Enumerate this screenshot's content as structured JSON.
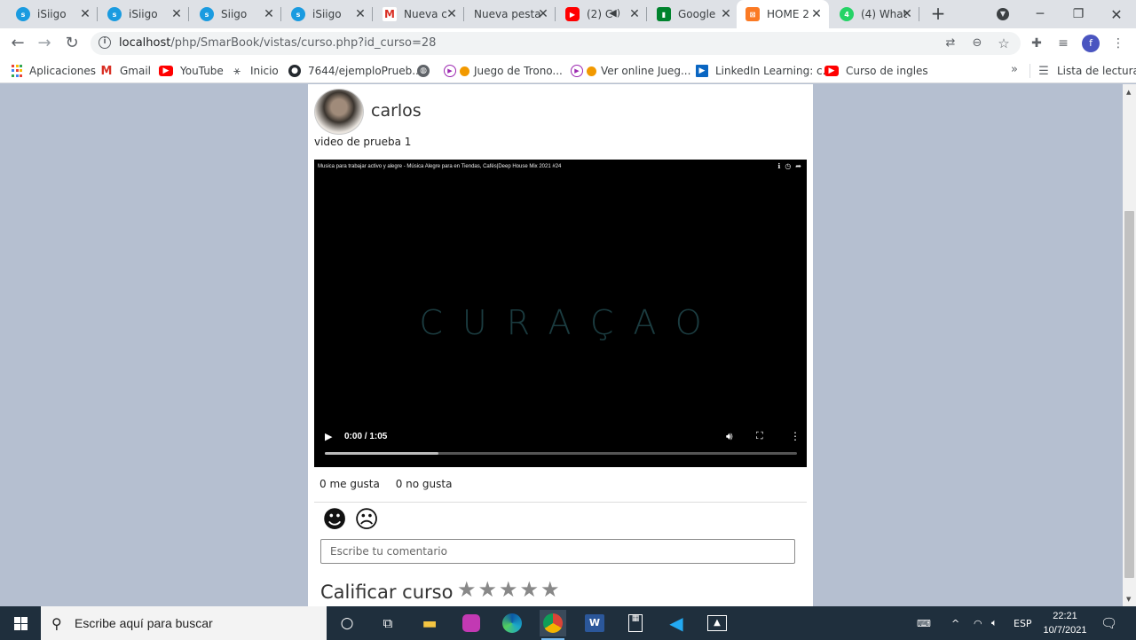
{
  "browser": {
    "tabs": [
      {
        "title": "iSiigo",
        "favicon": "siigo-icon",
        "color": "#1a9be0"
      },
      {
        "title": "iSiigo",
        "favicon": "siigo-icon",
        "color": "#1a9be0"
      },
      {
        "title": "Siigo",
        "favicon": "siigo-icon",
        "color": "#1a9be0"
      },
      {
        "title": "iSiigo",
        "favicon": "siigo-icon",
        "color": "#1a9be0"
      },
      {
        "title": "Nueva c",
        "favicon": "gmail-icon",
        "color": "#d93025"
      },
      {
        "title": "Nueva pesta",
        "favicon": "none",
        "color": "#dee1e6"
      },
      {
        "title": "(2) C",
        "favicon": "youtube-icon",
        "color": "#ff0000"
      },
      {
        "title": "Google",
        "favicon": "meet-icon",
        "color": "#00832d"
      },
      {
        "title": "HOME 2",
        "favicon": "xampp-icon",
        "color": "#fb7a24"
      },
      {
        "title": "(4) What",
        "favicon": "whatsapp-icon",
        "color": "#25d366"
      }
    ],
    "address": {
      "host": "localhost",
      "path": "/php/SmarBook/vistas/curso.php?id_curso=28"
    },
    "profile_initial": "f",
    "bookmarks": [
      {
        "label": "Aplicaciones",
        "icon": "apps-grid-icon",
        "color": "#ea4335"
      },
      {
        "label": "Gmail",
        "icon": "gmail-icon",
        "color": "#d93025"
      },
      {
        "label": "YouTube",
        "icon": "youtube-icon",
        "color": "#ff0000"
      },
      {
        "label": "Inicio",
        "icon": "sena-icon",
        "color": "#5f6368"
      },
      {
        "label": "7644/ejemploPrueb...",
        "icon": "github-icon",
        "color": "#24292e"
      },
      {
        "label": "",
        "icon": "globe-icon",
        "color": "#5f6368"
      },
      {
        "label": "Juego de Trono...",
        "icon": "play-badge-icon",
        "color": "#9c27b0"
      },
      {
        "label": "Ver online Jueg...",
        "icon": "play-badge-icon",
        "color": "#9c27b0"
      },
      {
        "label": "LinkedIn Learning: c...",
        "icon": "linkedin-learning-icon",
        "color": "#0a66c2"
      },
      {
        "label": "Curso de ingles",
        "icon": "youtube-icon",
        "color": "#ff0000"
      }
    ],
    "reading_list": "Lista de lectura"
  },
  "course": {
    "author": "carlos",
    "video_title": "video de prueba 1",
    "player": {
      "embedded_title": "Musica para trabajar activo y alegre - Música Alegre para en Tiendas, Cafés|Deep House Mix 2021 #24",
      "cover_text": "CURAÇAO",
      "time": "0:00 / 1:05",
      "buffered_fraction": 0.24
    },
    "likes_label": "0 me gusta",
    "dislikes_label": "0 no gusta",
    "like_emoji": "☻",
    "dislike_emoji": "☹",
    "comment_placeholder": "Escribe tu comentario",
    "rate_label": "Calificar curso",
    "stars": [
      "★",
      "★",
      "★",
      "★",
      "★"
    ]
  },
  "taskbar": {
    "search_placeholder": "Escribe aquí para buscar",
    "apps": [
      "cortana-icon",
      "task-view-icon",
      "file-explorer-icon",
      "app-icon",
      "edge-icon",
      "chrome-icon",
      "word-icon",
      "calculator-icon",
      "vscode-icon",
      "photos-icon"
    ],
    "language": "ESP",
    "time": "22:21",
    "date": "10/7/2021"
  }
}
